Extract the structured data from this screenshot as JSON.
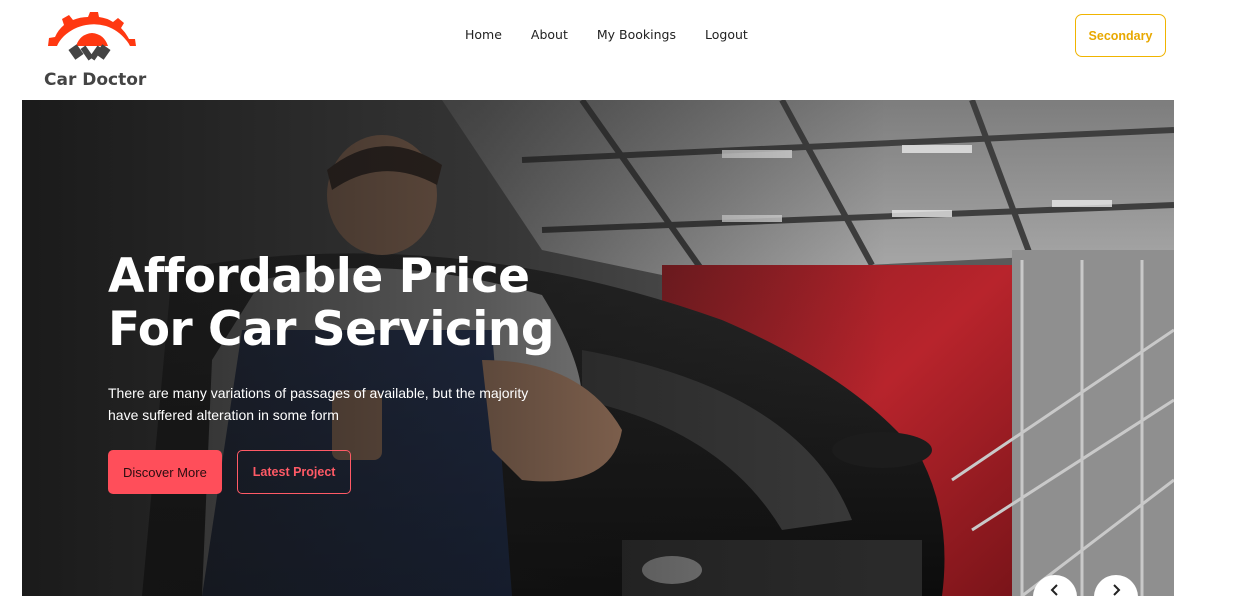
{
  "brand": {
    "name": "Car Doctor",
    "icon": "gear-pistons-logo",
    "accent": "#ff3811"
  },
  "nav": {
    "items": [
      {
        "label": "Home"
      },
      {
        "label": "About"
      },
      {
        "label": "My Bookings"
      },
      {
        "label": "Logout"
      }
    ],
    "cta_label": "Secondary",
    "cta_color": "#f0b400"
  },
  "hero": {
    "title_line1": "Affordable Price",
    "title_line2": "For Car Servicing",
    "description": "There are many variations of passages of available, but the majority have suffered alteration in some form",
    "primary_button": "Discover More",
    "secondary_button": "Latest Project",
    "button_color": "#ff4e5a",
    "prev_icon": "chevron-left-icon",
    "next_icon": "chevron-right-icon"
  }
}
